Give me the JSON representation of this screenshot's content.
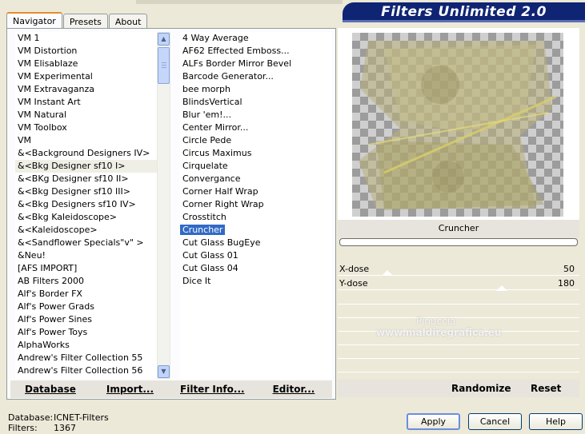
{
  "window": {
    "title": "Filters Unlimited 2.0"
  },
  "tabs": [
    {
      "label": "Navigator",
      "active": true
    },
    {
      "label": "Presets",
      "active": false
    },
    {
      "label": "About",
      "active": false
    }
  ],
  "categories": [
    "VM 1",
    "VM Distortion",
    "VM Elisablaze",
    "VM Experimental",
    "VM Extravaganza",
    "VM Instant Art",
    "VM Natural",
    "VM Toolbox",
    "VM",
    "&<Background Designers IV>",
    "&<Bkg Designer sf10 I>",
    "&<BKg Designer sf10 II>",
    "&<Bkg Designer sf10 III>",
    "&<Bkg Designers sf10 IV>",
    "&<Bkg Kaleidoscope>",
    "&<Kaleidoscope>",
    "&<Sandflower Specials\"v\" >",
    "&Neu!",
    "[AFS IMPORT]",
    "AB Filters 2000",
    "Alf's Border FX",
    "Alf's Power Grads",
    "Alf's Power Sines",
    "Alf's Power Toys",
    "AlphaWorks",
    "Andrew's Filter Collection 55",
    "Andrew's Filter Collection 56"
  ],
  "selected_category": "&<Bkg Designer sf10 I>",
  "filters": [
    "4 Way Average",
    "AF62 Effected Emboss...",
    "ALFs Border Mirror Bevel",
    "Barcode Generator...",
    "bee morph",
    "BlindsVertical",
    "Blur 'em!...",
    "Center Mirror...",
    "Circle Pede",
    "Circus Maximus",
    "Cirquelate",
    "Convergance",
    "Corner Half Wrap",
    "Corner Right Wrap",
    "Crosstitch",
    "Cruncher",
    "Cut Glass  BugEye",
    "Cut Glass 01",
    "Cut Glass 04",
    "Dice It"
  ],
  "selected_filter": "Cruncher",
  "left_buttons": {
    "database": "Database",
    "import": "Import...",
    "filter_info": "Filter Info...",
    "editor": "Editor..."
  },
  "preview": {
    "filter_name": "Cruncher",
    "progress": 0
  },
  "params": [
    {
      "label": "X-dose",
      "value": "50",
      "max": 255
    },
    {
      "label": "Y-dose",
      "value": "180",
      "max": 255
    }
  ],
  "right_buttons": {
    "randomize": "Randomize",
    "reset": "Reset"
  },
  "footer": {
    "database_label": "Database:",
    "database_value": "ICNET-Filters",
    "filters_label": "Filters:",
    "filters_value": "1367"
  },
  "dialog_buttons": {
    "apply": "Apply",
    "cancel": "Cancel",
    "help": "Help"
  },
  "watermark": {
    "brand": "Pinuccia",
    "site": "www.maldiregrafica.eu"
  }
}
